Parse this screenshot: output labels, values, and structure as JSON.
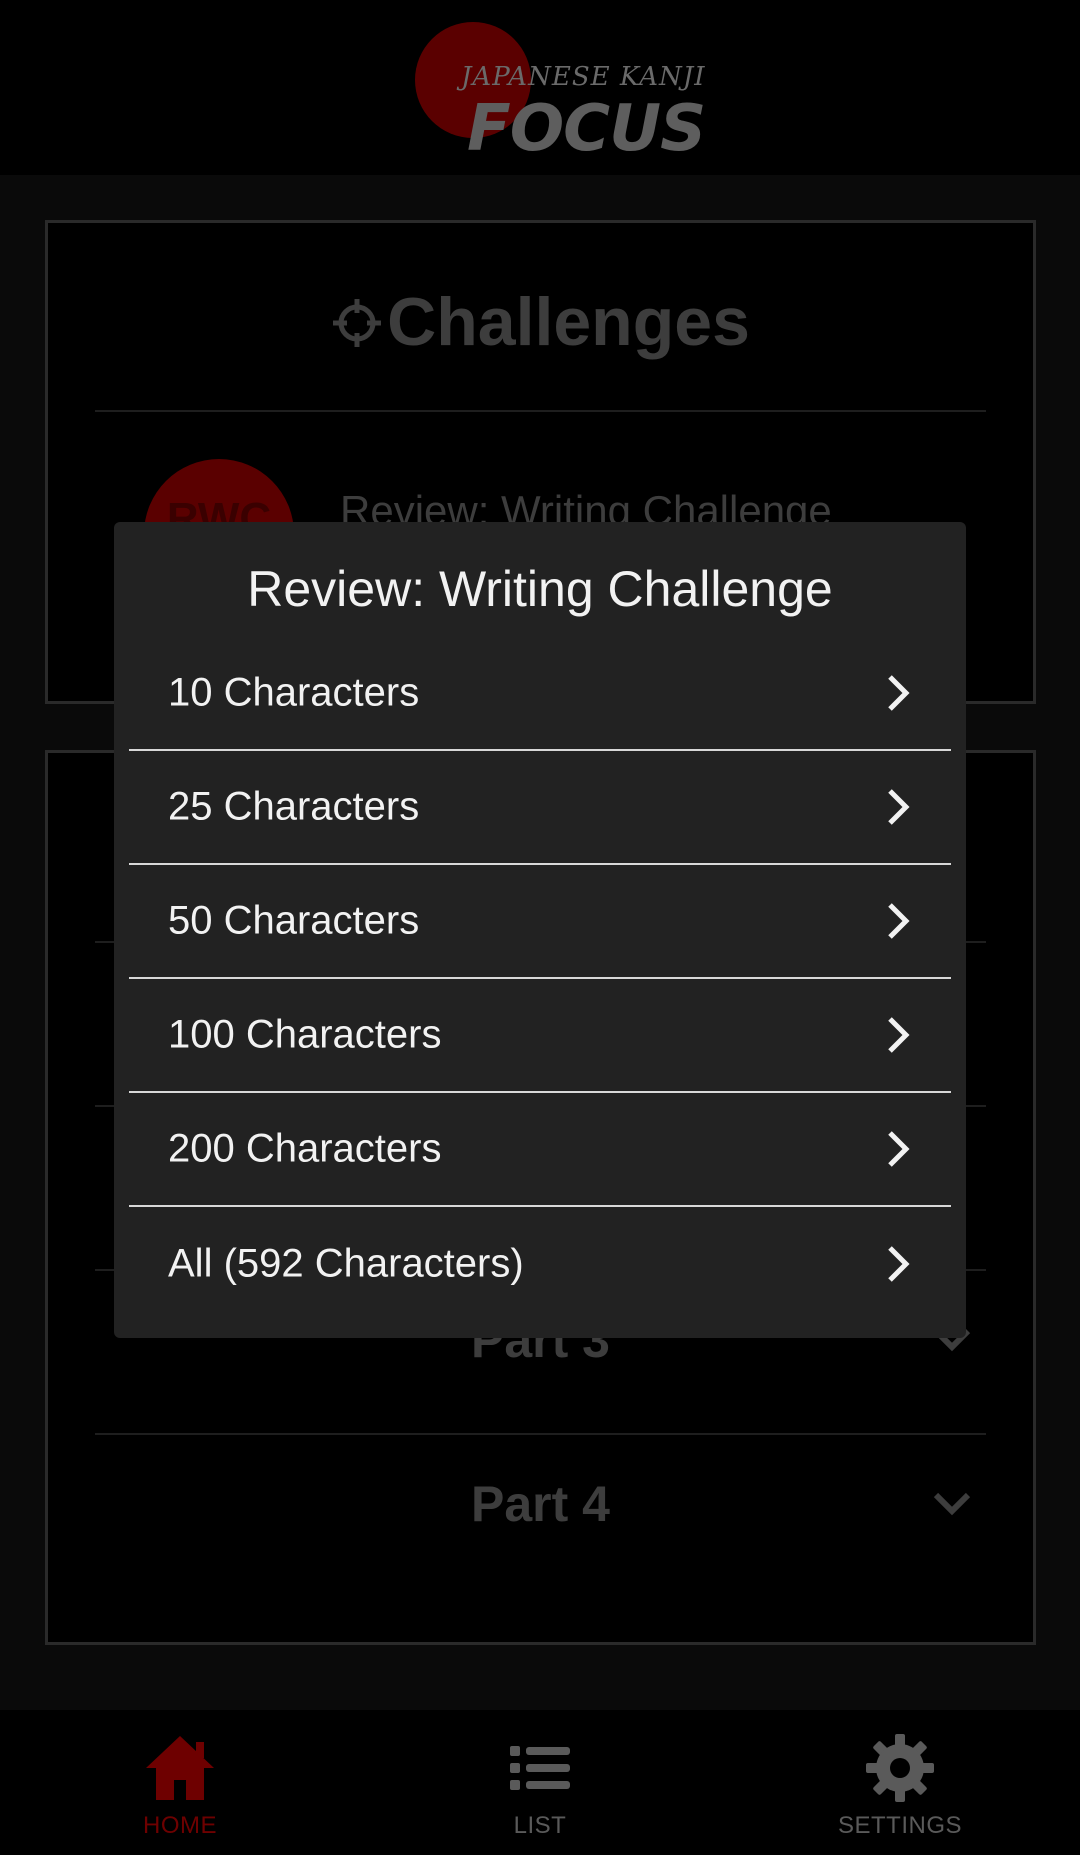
{
  "header": {
    "logo_small": "JAPANESE KANJI",
    "logo_big": "FOCUS",
    "logo_circle_color": "#5a0000"
  },
  "challenges_card": {
    "title": "Challenges",
    "icon": "crosshair-icon",
    "item": {
      "badge": "RWC",
      "title": "Review: Writing Challenge"
    }
  },
  "parts_card": {
    "parts": [
      {
        "label": "Part 3"
      },
      {
        "label": "Part 4"
      }
    ]
  },
  "modal": {
    "title": "Review: Writing Challenge",
    "options": [
      {
        "label": "10 Characters"
      },
      {
        "label": "25 Characters"
      },
      {
        "label": "50 Characters"
      },
      {
        "label": "100 Characters"
      },
      {
        "label": "200 Characters"
      },
      {
        "label": "All (592 Characters)"
      }
    ]
  },
  "bottom_nav": {
    "items": [
      {
        "label": "HOME",
        "icon": "home-icon",
        "active": true
      },
      {
        "label": "LIST",
        "icon": "list-icon",
        "active": false
      },
      {
        "label": "SETTINGS",
        "icon": "gear-icon",
        "active": false
      }
    ],
    "active_color": "#6e0000",
    "inactive_color": "#5a5a5a"
  }
}
